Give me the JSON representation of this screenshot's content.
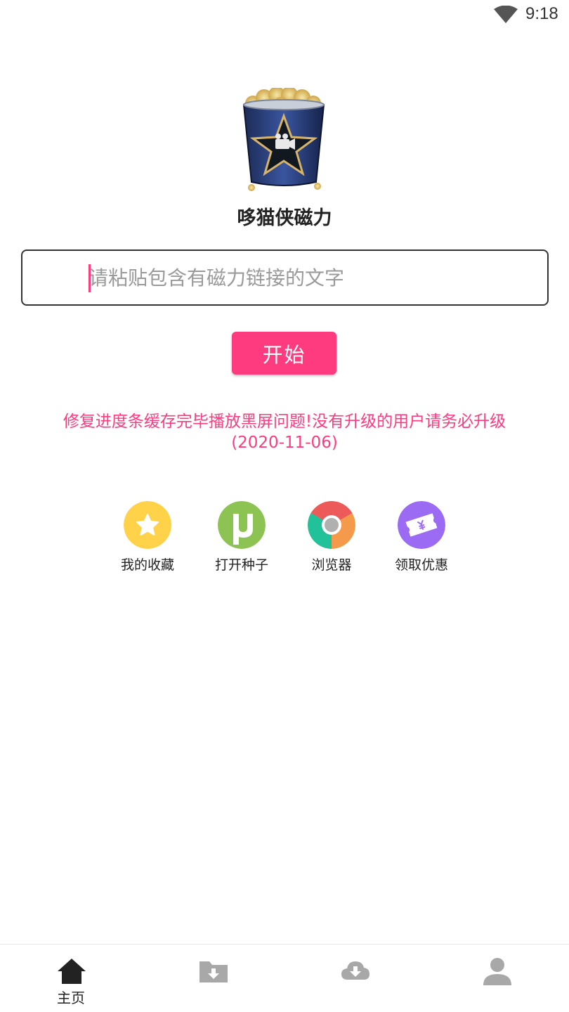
{
  "status_bar": {
    "time": "9:18"
  },
  "app": {
    "name": "哆猫侠磁力"
  },
  "search": {
    "placeholder": "请粘贴包含有磁力链接的文字",
    "value": ""
  },
  "start_button": {
    "label": "开始"
  },
  "notice": {
    "line1": "修复进度条缓存完毕播放黑屏问题!没有升级的用户请务必升级",
    "line2": "(2020-11-06)"
  },
  "shortcuts": [
    {
      "label": "我的收藏",
      "icon": "star-icon",
      "color": "#ffd24a"
    },
    {
      "label": "打开种子",
      "icon": "utorrent-icon",
      "color": "#8dc352"
    },
    {
      "label": "浏览器",
      "icon": "chrome-icon",
      "color": "#ec5a5a"
    },
    {
      "label": "领取优惠",
      "icon": "coupon-icon",
      "color": "#9b6bf3"
    }
  ],
  "bottom_nav": [
    {
      "label": "主页",
      "icon": "home-icon",
      "active": true
    },
    {
      "label": "",
      "icon": "download-folder-icon",
      "active": false
    },
    {
      "label": "",
      "icon": "cloud-download-icon",
      "active": false
    },
    {
      "label": "",
      "icon": "user-icon",
      "active": false
    }
  ],
  "colors": {
    "accent": "#ff3b7f",
    "inactive_icon": "#a8a8a8",
    "active_icon": "#222222"
  }
}
